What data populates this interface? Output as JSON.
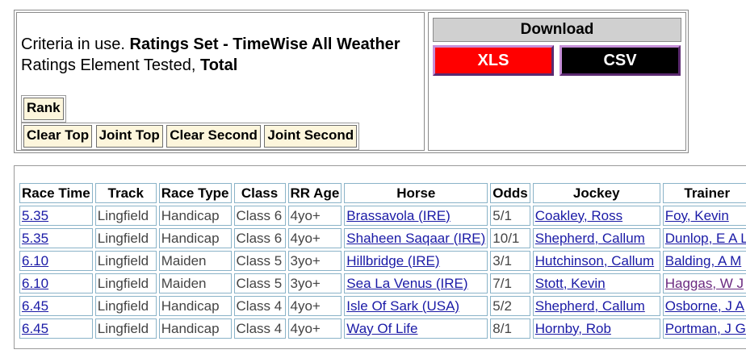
{
  "criteria": {
    "line1_prefix": "Criteria in use.",
    "line1_value": "Ratings Set - TimeWise All Weather",
    "line2_prefix": "Ratings Element Tested,",
    "line2_value": "Total"
  },
  "filters": {
    "rank_label": "Rank",
    "buttons": [
      "Clear Top",
      "Joint Top",
      "Clear Second",
      "Joint Second"
    ]
  },
  "download": {
    "heading": "Download",
    "xls_label": "XLS",
    "csv_label": "CSV",
    "xls_color": "#ff0000",
    "csv_color": "#000000"
  },
  "table": {
    "headers": [
      "Race Time",
      "Track",
      "Race Type",
      "Class",
      "RR Age",
      "Horse",
      "Odds",
      "Jockey",
      "Trainer"
    ],
    "rows": [
      {
        "time": "5.35",
        "track": "Lingfield",
        "type": "Handicap",
        "class": "Class 6",
        "age": "4yo+",
        "horse": "Brassavola (IRE)",
        "odds": "5/1",
        "jockey": "Coakley, Ross",
        "trainer": "Foy, Kevin"
      },
      {
        "time": "5.35",
        "track": "Lingfield",
        "type": "Handicap",
        "class": "Class 6",
        "age": "4yo+",
        "horse": "Shaheen Saqaar (IRE)",
        "odds": "10/1",
        "jockey": "Shepherd, Callum",
        "trainer": "Dunlop, E A L"
      },
      {
        "time": "6.10",
        "track": "Lingfield",
        "type": "Maiden",
        "class": "Class 5",
        "age": "3yo+",
        "horse": "Hillbridge (IRE)",
        "odds": "3/1",
        "jockey": "Hutchinson, Callum",
        "trainer": "Balding, A M"
      },
      {
        "time": "6.10",
        "track": "Lingfield",
        "type": "Maiden",
        "class": "Class 5",
        "age": "3yo+",
        "horse": "Sea La Venus (IRE)",
        "odds": "7/1",
        "jockey": "Stott, Kevin",
        "trainer": "Haggas, W J"
      },
      {
        "time": "6.45",
        "track": "Lingfield",
        "type": "Handicap",
        "class": "Class 4",
        "age": "4yo+",
        "horse": "Isle Of Sark (USA)",
        "odds": "5/2",
        "jockey": "Shepherd, Callum",
        "trainer": "Osborne, J A"
      },
      {
        "time": "6.45",
        "track": "Lingfield",
        "type": "Handicap",
        "class": "Class 4",
        "age": "4yo+",
        "horse": "Way Of Life",
        "odds": "8/1",
        "jockey": "Hornby, Rob",
        "trainer": "Portman, J G"
      }
    ]
  }
}
